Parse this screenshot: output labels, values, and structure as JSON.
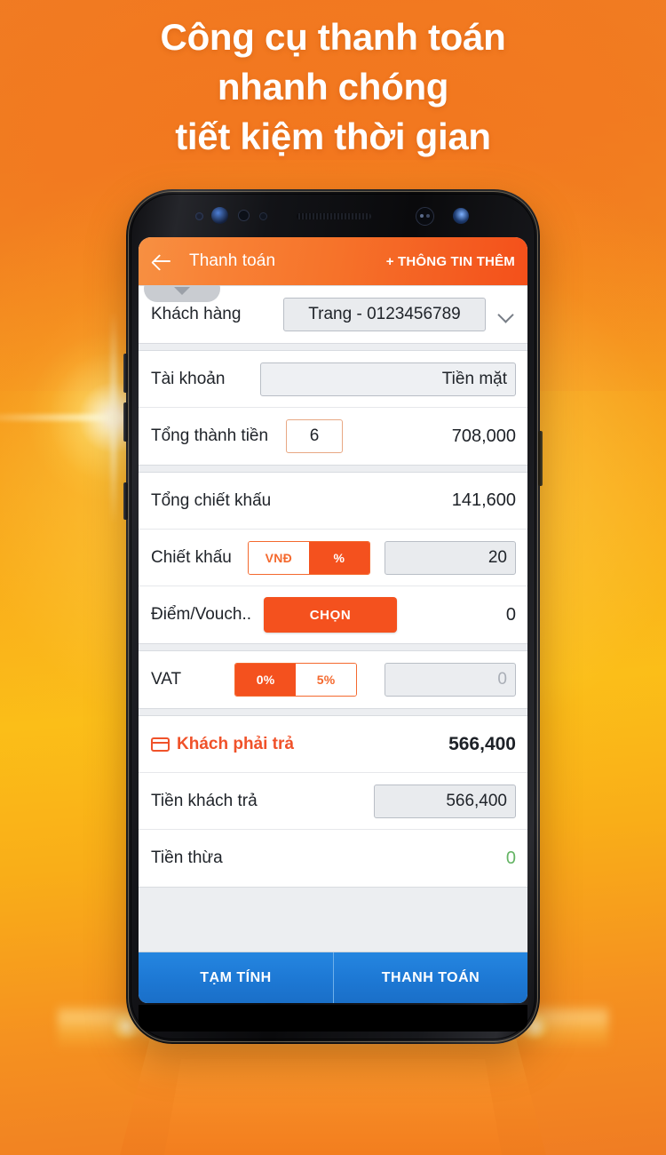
{
  "promo": {
    "headline_lines": [
      "Công cụ thanh toán",
      "nhanh chóng",
      "tiết kiệm thời gian"
    ]
  },
  "colors": {
    "brand_orange": "#f4511e",
    "appbar_left": "#f79042",
    "appbar_right": "#f4501a",
    "action_blue": "#1d78d4",
    "positive_green": "#64b464",
    "background_orange": "#f07c23",
    "background_yellow": "#fbbe17"
  },
  "appbar": {
    "back_icon": "arrow-left-icon",
    "title": "Thanh toán",
    "action_label": "+ THÔNG TIN THÊM"
  },
  "form": {
    "tooltip_pill": {
      "icon": "caret-down-icon"
    },
    "groups": [
      {
        "rows": [
          {
            "name": "customer",
            "label": "Khách hàng",
            "field_value": "Trang - 0123456789",
            "chevron_icon": "chevron-down-icon"
          }
        ]
      },
      {
        "rows": [
          {
            "name": "account",
            "label": "Tài khoản",
            "field_value": "Tiền mặt"
          },
          {
            "name": "total-amount",
            "label": "Tổng thành tiền",
            "qty_value": "6",
            "value": "708,000"
          }
        ]
      },
      {
        "rows": [
          {
            "name": "total-discount",
            "label": "Tổng chiết khấu",
            "value": "141,600"
          },
          {
            "name": "discount",
            "label": "Chiết khấu",
            "toggle": {
              "options": [
                "VNĐ",
                "%"
              ],
              "selected": "%"
            },
            "field_value": "20"
          },
          {
            "name": "points-voucher",
            "label": "Điểm/Vouch..",
            "button_label": "CHỌN",
            "value": "0"
          }
        ]
      },
      {
        "rows": [
          {
            "name": "vat",
            "label": "VAT",
            "toggle": {
              "options": [
                "0%",
                "5%"
              ],
              "selected": "0%"
            },
            "field_value": "0"
          }
        ]
      },
      {
        "rows": [
          {
            "name": "customer-must-pay",
            "icon": "credit-card-icon",
            "label": "Khách phải trả",
            "value": "566,400"
          },
          {
            "name": "customer-paid",
            "label": "Tiền khách trả",
            "field_value": "566,400"
          },
          {
            "name": "change-due",
            "label": "Tiền thừa",
            "value": "0"
          }
        ]
      }
    ]
  },
  "actions": {
    "provisional_label": "TẠM TÍNH",
    "pay_label": "THANH TOÁN"
  }
}
